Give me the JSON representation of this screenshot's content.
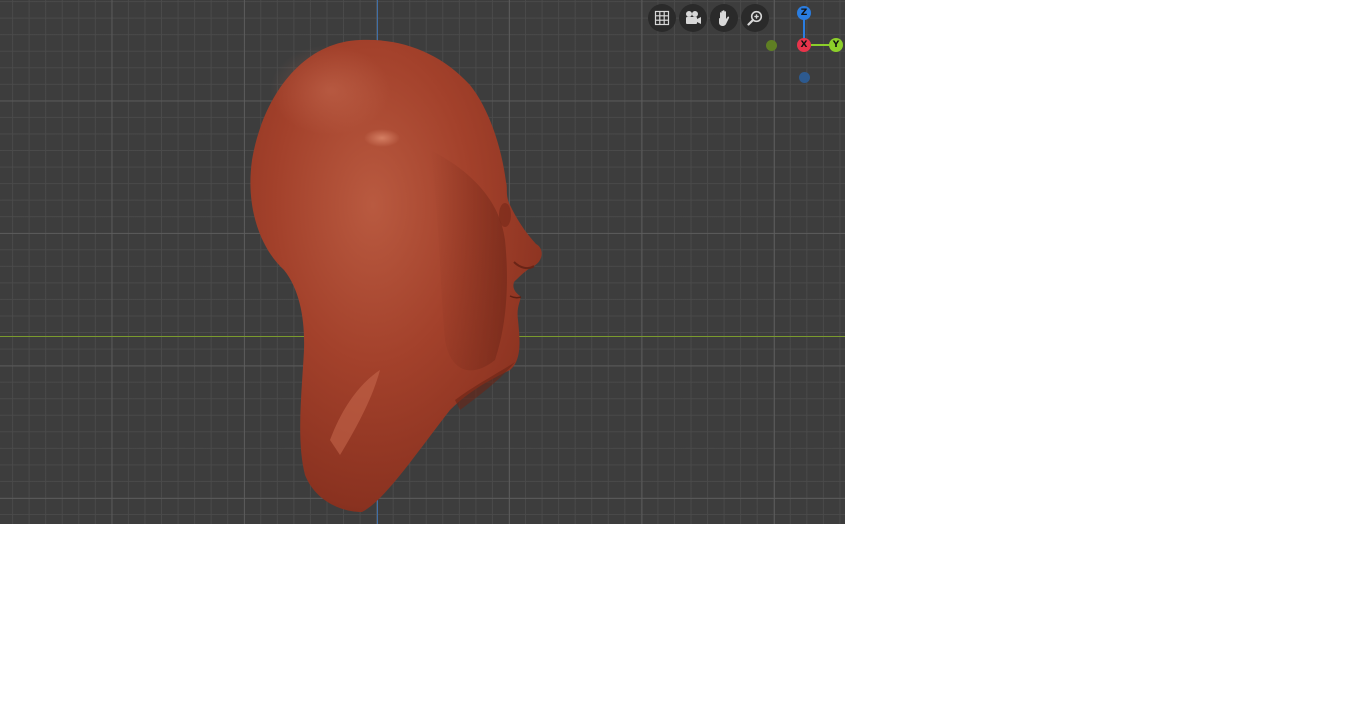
{
  "viewport": {
    "background": "#3d3d3d",
    "model_name": "sculpted-head",
    "model_color": "#a5432c"
  },
  "navigation_tools": [
    {
      "name": "toggle-grid",
      "icon": "grid-icon"
    },
    {
      "name": "camera",
      "icon": "camera-icon"
    },
    {
      "name": "pan",
      "icon": "hand-icon"
    },
    {
      "name": "zoom",
      "icon": "zoom-icon"
    }
  ],
  "gizmo": {
    "z": {
      "label": "Z",
      "color": "#2a7de0"
    },
    "x": {
      "label": "X",
      "color": "#e8344b"
    },
    "y": {
      "label": "Y",
      "color": "#8ccf2a"
    },
    "neg_y_color": "#5f7f23",
    "neg_z_color": "#2d5a8f"
  }
}
